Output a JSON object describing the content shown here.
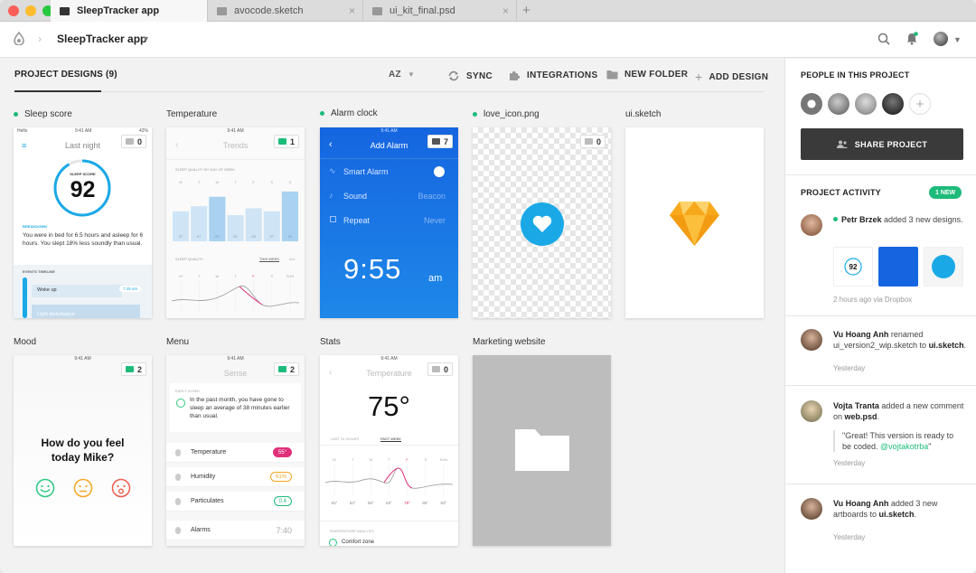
{
  "tabs": [
    {
      "label": "SleepTracker app",
      "active": true
    },
    {
      "label": "avocode.sketch",
      "active": false
    },
    {
      "label": "ui_kit_final.psd",
      "active": false
    }
  ],
  "toolbar": {
    "app_title": "SleepTracker app"
  },
  "section": {
    "title": "PROJECT DESIGNS (9)"
  },
  "actions": {
    "sort": "AZ",
    "sync": "SYNC",
    "integrations": "INTEGRATIONS",
    "new_folder": "NEW FOLDER",
    "add_design": "ADD DESIGN"
  },
  "cards": [
    {
      "name": "Sleep score",
      "comments": "0",
      "dot": true
    },
    {
      "name": "Temperature",
      "comments": "1",
      "dot": false
    },
    {
      "name": "Alarm clock",
      "comments": "7",
      "dot": true
    },
    {
      "name": "love_icon.png",
      "comments": "0",
      "dot": true
    },
    {
      "name": "ui.sketch",
      "comments": "",
      "dot": false
    },
    {
      "name": "Mood",
      "comments": "2",
      "dot": false
    },
    {
      "name": "Menu",
      "comments": "2",
      "dot": false
    },
    {
      "name": "Stats",
      "comments": "0",
      "dot": false
    },
    {
      "name": "Marketing website",
      "comments": "",
      "dot": false
    }
  ],
  "sleep": {
    "status_carrier": "Hello",
    "status_time": "9:41 AM",
    "status_batt": "42%",
    "title": "Last night",
    "score_label": "SLEEP SCORE",
    "score": "92",
    "breakdown": "BREAKDOWN",
    "desc": "You were in bed for 6.5 hours and asleep for 6 hours. You slept 18% less soundly than usual.",
    "timeline": "EVENTS TIMELINE",
    "woke": "Woke up",
    "woke_time": "7:45 am",
    "light": "Light disturbance"
  },
  "temp": {
    "status_time": "9:41 AM",
    "title": "Trends",
    "chart_label": "SLEEP QUALITY BY DAY OF WEEK",
    "days": [
      "M",
      "T",
      "W",
      "T",
      "F",
      "S",
      "S"
    ],
    "vals": [
      "57",
      "67",
      "85",
      "50",
      "63",
      "57",
      "95"
    ],
    "quality": "SLEEP QUALITY",
    "this_week": "THIS WEEK",
    "all": "ALL",
    "days2": [
      "M",
      "T",
      "W",
      "T",
      "F",
      "S",
      "SUN"
    ]
  },
  "alarm": {
    "status_time": "9:41 AM",
    "title": "Add Alarm",
    "smart": "Smart Alarm",
    "sound": "Sound",
    "sound_val": "Beacon",
    "repeat": "Repeat",
    "repeat_val": "Never",
    "time": "9:55",
    "ampm": "am"
  },
  "mood": {
    "status_time": "9:41 AM",
    "question": "How do you feel today Mike?"
  },
  "menu": {
    "status_time": "9:41 AM",
    "title": "Sense",
    "early": "EARLY IN BED",
    "note": "In the past month, you have gone to sleep an average of 38 minutes earlier than usual.",
    "items": [
      {
        "label": "Temperature",
        "val": "55°",
        "color": "#e0307a"
      },
      {
        "label": "Humidity",
        "val": "61%",
        "color": "#f5a623"
      },
      {
        "label": "Particulates",
        "val": "0.4",
        "color": "#1dbb7a"
      },
      {
        "label": "Alarms",
        "val": "7:40",
        "color": ""
      }
    ]
  },
  "stats": {
    "status_time": "9:41 AM",
    "title": "Temperature",
    "value": "75°",
    "tab1": "LAST 24 HOURS",
    "tab2": "PAST WEEK",
    "days": [
      "M",
      "T",
      "W",
      "T",
      "F",
      "S",
      "SUN"
    ],
    "vals": [
      "63°",
      "63°",
      "65°",
      "63°",
      "79°",
      "65°",
      "63°"
    ],
    "analysis": "TEMPERATURE ANALYSIS",
    "comfort": "Comfort zone"
  },
  "panel": {
    "people_title": "PEOPLE IN THIS PROJECT",
    "share": "SHARE PROJECT",
    "activity_title": "PROJECT ACTIVITY",
    "new_badge": "1 NEW",
    "feed": [
      {
        "name": "Petr Brzek",
        "text": " added 3 new designs.",
        "meta": "2 hours ago via Dropbox"
      },
      {
        "name": "Vu Hoang Anh",
        "text": " renamed ui_version2_wip.sketch to ",
        "target": "ui.sketch",
        "end": ".",
        "meta": "Yesterday"
      },
      {
        "name": "Vojta Tranta",
        "text": " added a new comment on ",
        "target": "web.psd",
        "end": ".",
        "quote": "\"Great! This version is ready to be coded. ",
        "mention": "@vojtakotrba",
        "quote_end": "\"",
        "meta": "Yesterday"
      },
      {
        "name": "Vu Hoang Anh",
        "text": " added 3 new artboards to ",
        "target": "ui.sketch",
        "end": ".",
        "meta": "Yesterday"
      }
    ]
  },
  "colors": {
    "accent": "#1dbb7a",
    "alarm_blue": "#1a73e8",
    "heart_blue": "#1aa9e6",
    "sketch_gold": "#f7a81b",
    "share_bg": "#3a3a3a"
  }
}
